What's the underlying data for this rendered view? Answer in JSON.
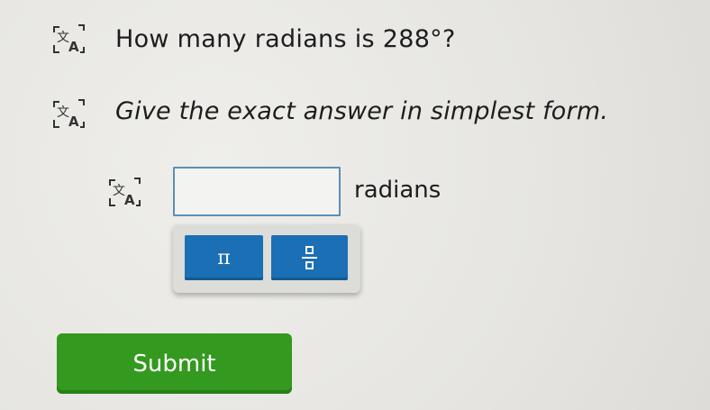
{
  "question": {
    "text": "How many radians is 288°?"
  },
  "instruction": {
    "text": "Give the exact answer in simplest form."
  },
  "answer": {
    "value": "",
    "unit": "radians"
  },
  "keypad": {
    "pi_label": "π"
  },
  "submit": {
    "label": "Submit"
  },
  "icons": [
    "translate-icon",
    "translate-icon",
    "translate-icon",
    "fraction-icon"
  ],
  "colors": {
    "accent_blue": "#1b6fb4",
    "submit_green": "#34991f",
    "input_border": "#5b8fb8"
  }
}
